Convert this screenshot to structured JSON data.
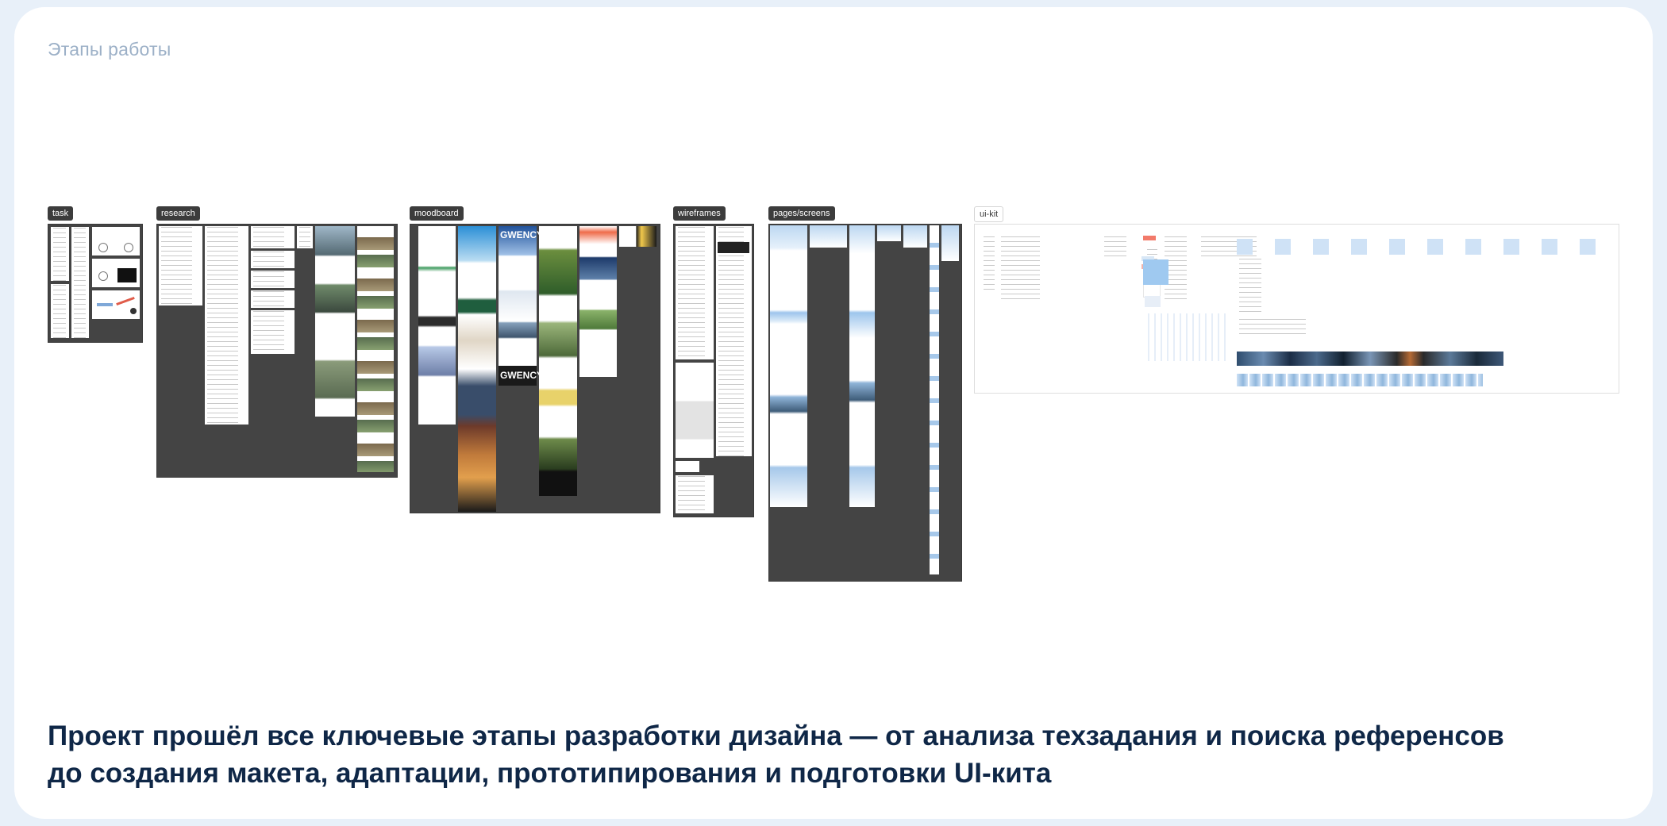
{
  "section_label": "Этапы работы",
  "caption": {
    "line1": "Проект прошёл все ключевые этапы разработки дизайна — от анализа техзадания и поиска референсов",
    "line2": "до создания макета, адаптации, прототипирования и подготовки UI-кита"
  },
  "stages": {
    "task": "task",
    "research": "research",
    "moodboard": "moodboard",
    "wireframes": "wireframes",
    "pages": "pages/screens",
    "uikit": "ui-kit"
  },
  "moodboard_text": {
    "gwency_1": "GWENCY",
    "gwency_2": "GWENCY"
  },
  "colors": {
    "page_bg": "#e8f0f9",
    "card_bg": "#ffffff",
    "caption": "#0f2747",
    "label": "#9cb0c7",
    "frame_dark": "#444444",
    "accent_blue": "#cfe2f6"
  }
}
